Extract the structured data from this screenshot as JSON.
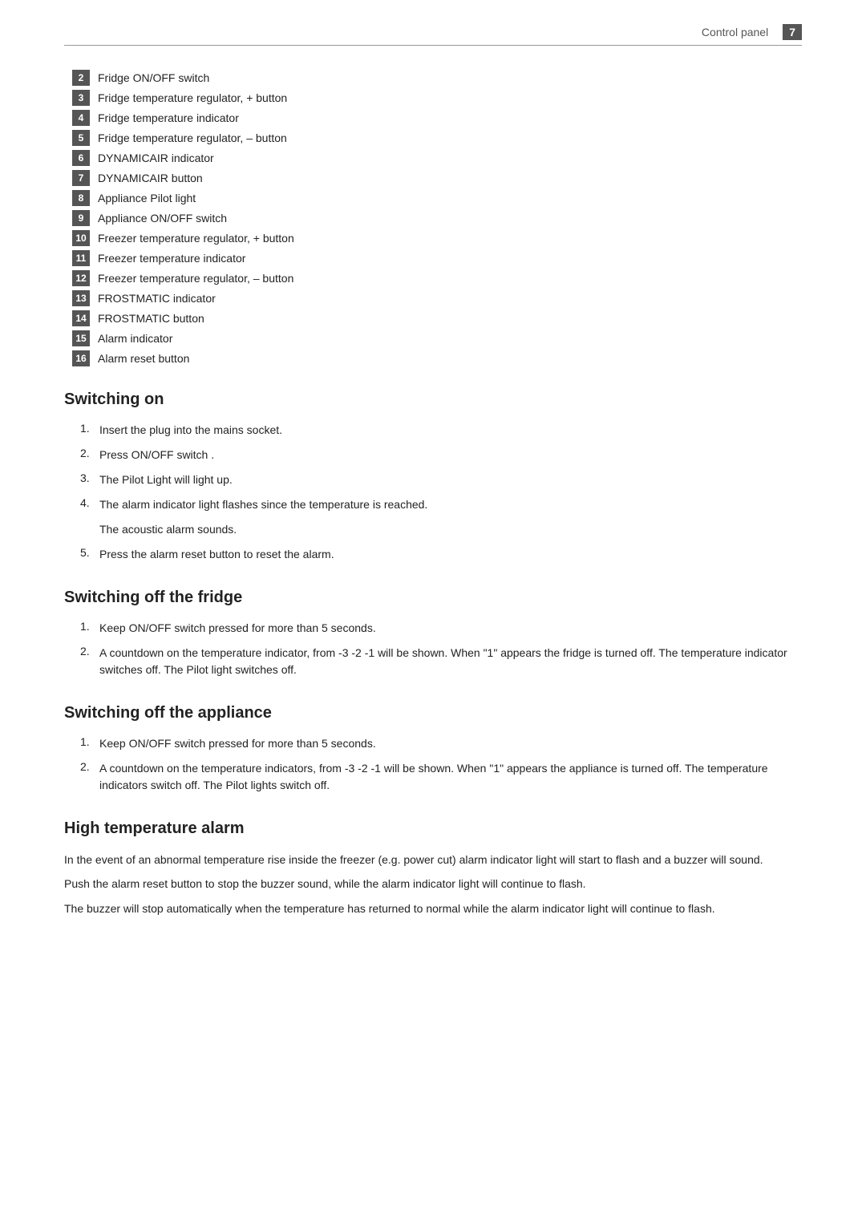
{
  "header": {
    "title": "Control panel",
    "page": "7"
  },
  "items": [
    {
      "num": "2",
      "label": "Fridge ON/OFF switch"
    },
    {
      "num": "3",
      "label": "Fridge temperature regulator, + button"
    },
    {
      "num": "4",
      "label": "Fridge temperature indicator"
    },
    {
      "num": "5",
      "label": "Fridge temperature regulator, – button"
    },
    {
      "num": "6",
      "label": "DYNAMICAIR indicator"
    },
    {
      "num": "7",
      "label": "DYNAMICAIR button"
    },
    {
      "num": "8",
      "label": "Appliance Pilot light"
    },
    {
      "num": "9",
      "label": "Appliance ON/OFF switch"
    },
    {
      "num": "10",
      "label": "Freezer temperature regulator, + button"
    },
    {
      "num": "11",
      "label": "Freezer temperature indicator"
    },
    {
      "num": "12",
      "label": "Freezer temperature regulator, – button"
    },
    {
      "num": "13",
      "label": "FROSTMATIC indicator"
    },
    {
      "num": "14",
      "label": "FROSTMATIC button"
    },
    {
      "num": "15",
      "label": "Alarm indicator"
    },
    {
      "num": "16",
      "label": "Alarm reset button"
    }
  ],
  "switching_on": {
    "title": "Switching on",
    "steps": [
      {
        "num": "1.",
        "text": "Insert the plug into the mains socket."
      },
      {
        "num": "2.",
        "text": "Press ON/OFF switch ."
      },
      {
        "num": "3.",
        "text": "The Pilot Light will light up."
      },
      {
        "num": "4.",
        "text": "The alarm indicator light flashes since the temperature is reached."
      }
    ],
    "sub_step_4": "The acoustic alarm sounds.",
    "step_5": {
      "num": "5.",
      "text": "Press the alarm reset button to reset the alarm."
    }
  },
  "switching_off_fridge": {
    "title": "Switching off the fridge",
    "steps": [
      {
        "num": "1.",
        "text": "Keep ON/OFF switch pressed for more than 5 seconds."
      },
      {
        "num": "2.",
        "text": "A countdown on the temperature indicator, from -3 -2 -1 will be shown. When \"1\" appears the fridge is turned off. The temperature indicator switches off. The Pilot light switches off."
      }
    ]
  },
  "switching_off_appliance": {
    "title": "Switching off the appliance",
    "steps": [
      {
        "num": "1.",
        "text": "Keep ON/OFF switch pressed for more than 5 seconds."
      },
      {
        "num": "2.",
        "text": "A countdown on the temperature indicators, from -3 -2 -1 will be shown. When \"1\" appears the appliance is turned off. The temperature indicators switch off. The Pilot lights switch off."
      }
    ]
  },
  "high_temp_alarm": {
    "title": "High temperature alarm",
    "paragraphs": [
      "In the event of an abnormal temperature rise inside the freezer (e.g. power cut) alarm indicator light will start to flash and a buzzer will sound.",
      "Push the alarm reset button to stop the buzzer sound, while the alarm indicator light will continue to flash.",
      "The buzzer will stop automatically when the temperature has returned to normal while the alarm indicator light will continue to flash."
    ]
  }
}
